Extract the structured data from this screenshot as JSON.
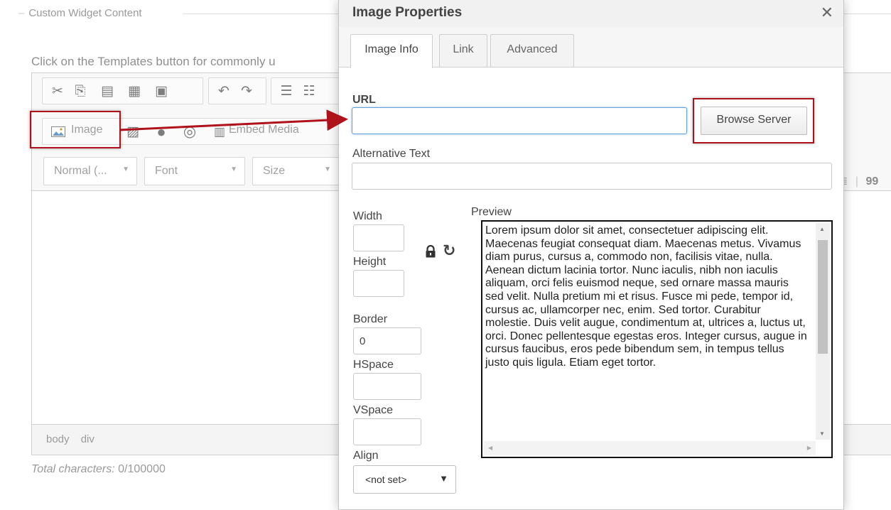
{
  "page": {
    "legend": "Custom Widget Content",
    "instructions": "Click on the Templates button for commonly u",
    "editor_toolbar": {
      "image_label": "Image",
      "embed_media_label": "Embed Media",
      "format_combo": "Normal (...",
      "font_combo": "Font",
      "size_combo": "Size",
      "blockquote_mark": "99"
    },
    "elements_path": [
      "body",
      "div"
    ],
    "char_count_label": "Total characters:",
    "char_count_value": "0/100000"
  },
  "dialog": {
    "title": "Image Properties",
    "close_glyph": "✕",
    "tabs": [
      {
        "label": "Image Info",
        "active": true
      },
      {
        "label": "Link",
        "active": false
      },
      {
        "label": "Advanced",
        "active": false
      }
    ],
    "url_label": "URL",
    "url_value": "",
    "browse_button": "Browse Server",
    "alt_text_label": "Alternative Text",
    "alt_text_value": "",
    "width_label": "Width",
    "width_value": "",
    "height_label": "Height",
    "height_value": "",
    "border_label": "Border",
    "border_value": "0",
    "hspace_label": "HSpace",
    "hspace_value": "",
    "vspace_label": "VSpace",
    "vspace_value": "",
    "align_label": "Align",
    "align_value": "<not set>",
    "preview_label": "Preview",
    "preview_text": "Lorem ipsum dolor sit amet, consectetuer adipiscing elit. Maecenas feugiat consequat diam. Maecenas metus. Vivamus diam purus, cursus a, commodo non, facilisis vitae, nulla. Aenean dictum lacinia tortor. Nunc iaculis, nibh non iaculis aliquam, orci felis euismod neque, sed ornare massa mauris sed velit. Nulla pretium mi et risus. Fusce mi pede, tempor id, cursus ac, ullamcorper nec, enim. Sed tortor. Curabitur molestie. Duis velit augue, condimentum at, ultrices a, luctus ut, orci. Donec pellentesque egestas eros. Integer cursus, augue in cursus faucibus, eros pede bibendum sem, in tempus tellus justo quis ligula. Etiam eget tortor."
  },
  "colors": {
    "annotation_red": "#b0121c",
    "focus_blue": "#62a0d8"
  },
  "icons": [
    "cut-icon",
    "copy-icon",
    "paste-icon",
    "paste-text-icon",
    "paste-word-icon",
    "undo-icon",
    "redo-icon",
    "numbered-list-icon",
    "bulleted-list-icon",
    "image-icon",
    "flash-icon",
    "special-char-icon",
    "iframe-icon",
    "embed-media-icon",
    "lock-icon",
    "reset-size-icon",
    "close-icon"
  ]
}
